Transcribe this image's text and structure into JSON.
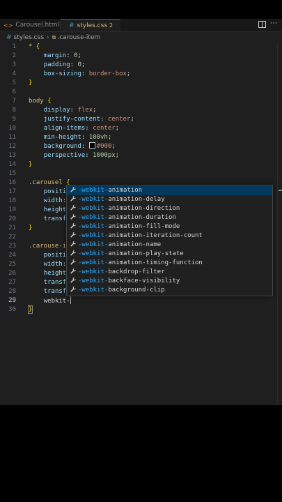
{
  "tabs": [
    {
      "icon": "<>",
      "label": "Carousel.html"
    },
    {
      "icon": "#",
      "label": "styles.css",
      "problems": "2",
      "modified": true
    }
  ],
  "breadcrumb": {
    "file": "styles.css",
    "symbol": ".carouse-item"
  },
  "lines": [
    {
      "n": "1",
      "tokens": [
        {
          "t": "* ",
          "c": "sel"
        },
        {
          "t": "{",
          "c": "br"
        }
      ]
    },
    {
      "n": "2",
      "tokens": [
        {
          "t": "    "
        },
        {
          "t": "margin",
          "c": "prop"
        },
        {
          "t": ": ",
          "c": "pun"
        },
        {
          "t": "0",
          "c": "num"
        },
        {
          "t": ";",
          "c": "pun"
        }
      ]
    },
    {
      "n": "3",
      "tokens": [
        {
          "t": "    "
        },
        {
          "t": "padding",
          "c": "prop"
        },
        {
          "t": ": ",
          "c": "pun"
        },
        {
          "t": "0",
          "c": "num"
        },
        {
          "t": ";",
          "c": "pun"
        }
      ]
    },
    {
      "n": "4",
      "tokens": [
        {
          "t": "    "
        },
        {
          "t": "box-sizing",
          "c": "prop"
        },
        {
          "t": ": ",
          "c": "pun"
        },
        {
          "t": "border-box",
          "c": "val"
        },
        {
          "t": ";",
          "c": "pun"
        }
      ]
    },
    {
      "n": "5",
      "tokens": [
        {
          "t": "}",
          "c": "br"
        }
      ]
    },
    {
      "n": "6",
      "tokens": []
    },
    {
      "n": "7",
      "tokens": [
        {
          "t": "body ",
          "c": "sel"
        },
        {
          "t": "{",
          "c": "br"
        }
      ]
    },
    {
      "n": "8",
      "tokens": [
        {
          "t": "    "
        },
        {
          "t": "display",
          "c": "prop"
        },
        {
          "t": ": ",
          "c": "pun"
        },
        {
          "t": "flex",
          "c": "val"
        },
        {
          "t": ";",
          "c": "pun"
        }
      ]
    },
    {
      "n": "9",
      "tokens": [
        {
          "t": "    "
        },
        {
          "t": "justify-content",
          "c": "prop"
        },
        {
          "t": ": ",
          "c": "pun"
        },
        {
          "t": "center",
          "c": "val"
        },
        {
          "t": ";",
          "c": "pun"
        }
      ]
    },
    {
      "n": "10",
      "tokens": [
        {
          "t": "    "
        },
        {
          "t": "align-items",
          "c": "prop"
        },
        {
          "t": ": ",
          "c": "pun"
        },
        {
          "t": "center",
          "c": "val"
        },
        {
          "t": ";",
          "c": "pun"
        }
      ]
    },
    {
      "n": "11",
      "tokens": [
        {
          "t": "    "
        },
        {
          "t": "min-height",
          "c": "prop"
        },
        {
          "t": ": ",
          "c": "pun"
        },
        {
          "t": "100vh",
          "c": "num"
        },
        {
          "t": ";",
          "c": "pun"
        }
      ]
    },
    {
      "n": "12",
      "tokens": [
        {
          "t": "    "
        },
        {
          "t": "background",
          "c": "prop"
        },
        {
          "t": ": ",
          "c": "pun"
        },
        {
          "t": "",
          "c": "swatch"
        },
        {
          "t": "#000",
          "c": "val"
        },
        {
          "t": ";",
          "c": "pun"
        }
      ]
    },
    {
      "n": "13",
      "tokens": [
        {
          "t": "    "
        },
        {
          "t": "perspective",
          "c": "prop"
        },
        {
          "t": ": ",
          "c": "pun"
        },
        {
          "t": "1000px",
          "c": "num"
        },
        {
          "t": ";",
          "c": "pun"
        }
      ]
    },
    {
      "n": "14",
      "tokens": [
        {
          "t": "}",
          "c": "br"
        }
      ]
    },
    {
      "n": "15",
      "tokens": []
    },
    {
      "n": "16",
      "tokens": [
        {
          "t": ".carousel ",
          "c": "sel"
        },
        {
          "t": "{",
          "c": "br"
        }
      ]
    },
    {
      "n": "17",
      "tokens": [
        {
          "t": "    "
        },
        {
          "t": "positi",
          "c": "prop"
        }
      ]
    },
    {
      "n": "18",
      "tokens": [
        {
          "t": "    "
        },
        {
          "t": "width:",
          "c": "prop"
        }
      ]
    },
    {
      "n": "19",
      "tokens": [
        {
          "t": "    "
        },
        {
          "t": "height",
          "c": "prop"
        }
      ]
    },
    {
      "n": "20",
      "tokens": [
        {
          "t": "    "
        },
        {
          "t": "transf",
          "c": "prop"
        }
      ]
    },
    {
      "n": "21",
      "tokens": [
        {
          "t": "}",
          "c": "br"
        }
      ]
    },
    {
      "n": "22",
      "tokens": []
    },
    {
      "n": "23",
      "tokens": [
        {
          "t": ".carouse-it",
          "c": "sel"
        }
      ]
    },
    {
      "n": "24",
      "tokens": [
        {
          "t": "    "
        },
        {
          "t": "positi",
          "c": "prop"
        }
      ]
    },
    {
      "n": "25",
      "tokens": [
        {
          "t": "    "
        },
        {
          "t": "width:",
          "c": "prop"
        }
      ]
    },
    {
      "n": "26",
      "tokens": [
        {
          "t": "    "
        },
        {
          "t": "height",
          "c": "prop"
        }
      ]
    },
    {
      "n": "27",
      "tokens": [
        {
          "t": "    "
        },
        {
          "t": "transf",
          "c": "prop"
        }
      ]
    },
    {
      "n": "28",
      "tokens": [
        {
          "t": "    "
        },
        {
          "t": "transf",
          "c": "prop"
        }
      ]
    },
    {
      "n": "29",
      "tokens": [
        {
          "t": "    "
        },
        {
          "t": "webkit-",
          "c": "plain"
        },
        {
          "t": "",
          "c": "cursor"
        }
      ]
    },
    {
      "n": "30",
      "tokens": [
        {
          "t": "}",
          "c": "br box"
        }
      ]
    }
  ],
  "current_line": "29",
  "suggestions": [
    {
      "match": "-webkit-",
      "rest": "animation"
    },
    {
      "match": "-webkit-",
      "rest": "animation-delay"
    },
    {
      "match": "-webkit-",
      "rest": "animation-direction"
    },
    {
      "match": "-webkit-",
      "rest": "animation-duration"
    },
    {
      "match": "-webkit-",
      "rest": "animation-fill-mode"
    },
    {
      "match": "-webkit-",
      "rest": "animation-iteration-count"
    },
    {
      "match": "-webkit-",
      "rest": "animation-name"
    },
    {
      "match": "-webkit-",
      "rest": "animation-play-state"
    },
    {
      "match": "-webkit-",
      "rest": "animation-timing-function"
    },
    {
      "match": "-webkit-",
      "rest": "backdrop-filter"
    },
    {
      "match": "-webkit-",
      "rest": "backface-visibility"
    },
    {
      "match": "-webkit-",
      "rest": "background-clip"
    }
  ],
  "suggest_icon": "wrench-icon",
  "colors": {
    "editor_bg": "#1f1f1f",
    "selection": "#04395e",
    "match": "#2aaaff"
  }
}
